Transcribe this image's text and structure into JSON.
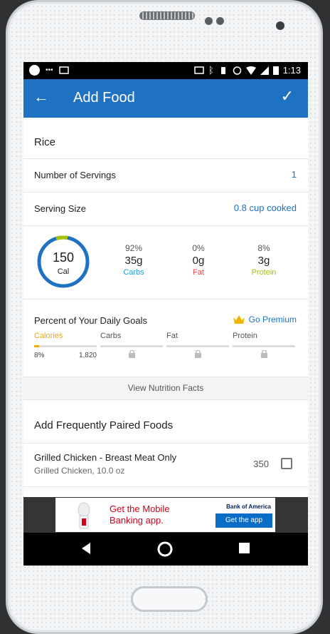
{
  "status_bar": {
    "time": "1:13"
  },
  "app_bar": {
    "title": "Add Food"
  },
  "food": {
    "name": "Rice"
  },
  "servings": {
    "label": "Number of Servings",
    "value": "1"
  },
  "serving_size": {
    "label": "Serving Size",
    "value": "0.8 cup cooked"
  },
  "calories": {
    "value": "150",
    "unit": "Cal"
  },
  "macros": [
    {
      "pct": "92%",
      "grams": "35g",
      "name": "Carbs",
      "color": "#1f9fd0"
    },
    {
      "pct": "0%",
      "grams": "0g",
      "name": "Fat",
      "color": "#e8464e"
    },
    {
      "pct": "8%",
      "grams": "3g",
      "name": "Protein",
      "color": "#a8c400"
    }
  ],
  "daily_goals": {
    "title": "Percent of Your Daily Goals",
    "premium_label": "Go Premium",
    "columns": [
      {
        "label": "Calories",
        "percent": "8%",
        "goal": "1,820",
        "fill_fraction": 0.08,
        "locked": false
      },
      {
        "label": "Carbs",
        "locked": true
      },
      {
        "label": "Fat",
        "locked": true
      },
      {
        "label": "Protein",
        "locked": true
      }
    ]
  },
  "nutrition_facts_label": "View Nutrition Facts",
  "paired_foods": {
    "title": "Add Frequently Paired Foods",
    "items": [
      {
        "name": "Grilled Chicken - Breast Meat Only",
        "subtitle": "Grilled Chicken, 10.0 oz",
        "calories": "350"
      }
    ]
  },
  "ad": {
    "line1": "Get the Mobile",
    "line2": "Banking app.",
    "brand": "Bank of America",
    "cta": "Get the app"
  },
  "colors": {
    "accent": "#1f72c2",
    "ring": "#1f72c2",
    "ring_protein": "#a8c400",
    "calories_label": "#f2a900"
  },
  "icons": [
    "back-arrow-icon",
    "check-icon",
    "crown-icon",
    "lock-icon",
    "checkbox-icon",
    "nav-back-icon",
    "nav-home-icon",
    "nav-recents-icon"
  ]
}
